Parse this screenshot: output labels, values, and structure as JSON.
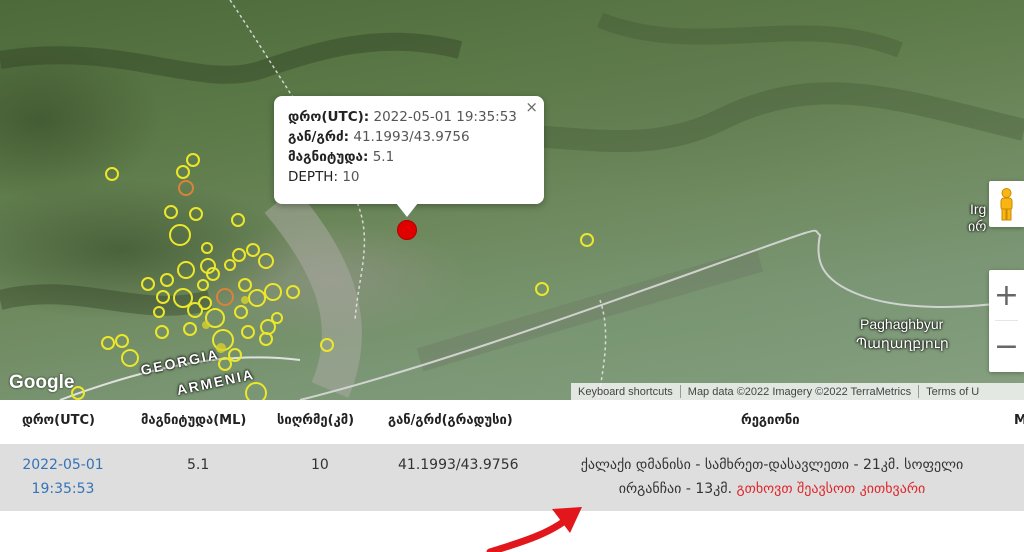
{
  "map": {
    "popup": {
      "rows": [
        {
          "key": "დრო(UTC):",
          "value": "2022-05-01 19:35:53"
        },
        {
          "key": "გან/გრძ:",
          "value": "41.1993/43.9756"
        },
        {
          "key": "მაგნიტუდა:",
          "value": "5.1"
        },
        {
          "key": "DEPTH:",
          "value": "10"
        }
      ],
      "close": "×"
    },
    "place_labels": {
      "georgia": "GEORGIA",
      "armenia": "ARMENIA",
      "paghaghbyur": "Paghaghbyur",
      "paghaghbyur_native": "Պաղաղբյուր",
      "ir": "Irg",
      "ir_native": "ირ"
    },
    "zoom_in": "+",
    "zoom_out": "−",
    "google_logo": "Google",
    "attribution": {
      "shortcuts": "Keyboard shortcuts",
      "data": "Map data ©2022 Imagery ©2022 TerraMetrics",
      "terms": "Terms of U"
    },
    "colors": {
      "quake_main": "#e00000",
      "quake_other": "#e9e52a"
    }
  },
  "table": {
    "headers": {
      "time": "დრო(UTC)",
      "magnitude": "მაგნიტუდა(ML)",
      "depth": "სიღრმე(კმ)",
      "coords": "გან/გრძ(გრადუსი)",
      "region": "რეგიონი",
      "extra": "M"
    },
    "row": {
      "date": "2022-05-01",
      "time": "19:35:53",
      "magnitude": "5.1",
      "depth": "10",
      "coords": "41.1993/43.9756",
      "region_line1": "ქალაქი დმანისი - სამხრეთ-დასავლეთი - 21კმ. სოფელი",
      "region_line2": "ირგანჩაი - 13კმ.",
      "report_link": "გთხოვთ შეავსოთ კითხვარი"
    }
  }
}
